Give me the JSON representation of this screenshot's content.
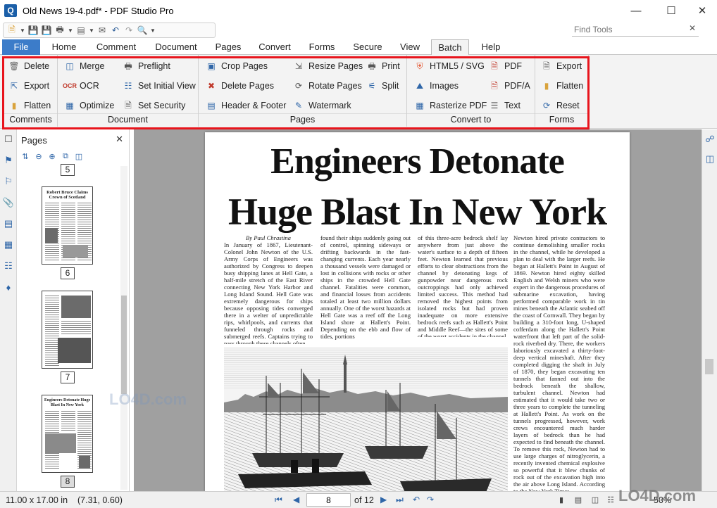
{
  "window": {
    "title": "Old News 19-4.pdf* - PDF Studio Pro",
    "logo": "Q"
  },
  "find_tools": {
    "placeholder": "Find Tools"
  },
  "menu": {
    "tabs": [
      {
        "label": "File"
      },
      {
        "label": "Home"
      },
      {
        "label": "Comment"
      },
      {
        "label": "Document"
      },
      {
        "label": "Pages"
      },
      {
        "label": "Convert"
      },
      {
        "label": "Forms"
      },
      {
        "label": "Secure"
      },
      {
        "label": "View"
      },
      {
        "label": "Batch"
      },
      {
        "label": "Help"
      }
    ],
    "active_tab": "Batch"
  },
  "ribbon": {
    "groups": [
      {
        "label": "Comments",
        "buttons": [
          "Delete",
          "Export",
          "Flatten"
        ]
      },
      {
        "label": "Document",
        "buttons": [
          "Merge",
          "OCR",
          "Optimize",
          "Preflight",
          "Set Initial View",
          "Set Security"
        ]
      },
      {
        "label": "Pages",
        "buttons": [
          "Crop Pages",
          "Delete Pages",
          "Header & Footer",
          "Resize Pages",
          "Rotate Pages",
          "Watermark",
          "Print",
          "Split"
        ]
      },
      {
        "label": "Convert to",
        "buttons": [
          "HTML5 / SVG",
          "Images",
          "Rasterize PDF",
          "PDF",
          "PDF/A",
          "Text"
        ]
      },
      {
        "label": "Forms",
        "buttons": [
          "Export",
          "Flatten",
          "Reset"
        ]
      }
    ],
    "highlight_color": "#e8141c"
  },
  "pages_panel": {
    "title": "Pages",
    "thumbnails": [
      {
        "number": "5"
      },
      {
        "number": "6",
        "title": "Robert Bruce Claims Crown of Scotland"
      },
      {
        "number": "7"
      },
      {
        "number": "8",
        "title": "Engineers Detonate Huge Blast In New York",
        "selected": true
      }
    ]
  },
  "document": {
    "headline_line1": "Engineers Detonate",
    "headline_line2": "Huge Blast In New York",
    "byline": "By Paul Chrastina",
    "columns": [
      "In January of 1867, Lieutenant-Colonel John Newton of the U.S. Army Corps of Engineers was authorized by Congress to deepen busy shipping lanes at Hell Gate, a half-mile stretch of the East River connecting New York Harbor and Long Island Sound. Hell Gate was extremely dangerous for ships because opposing tides converged there in a welter of unpredictable rips, whirlpools, and currents that funneled through rocks and submerged reefs. Captains trying to pass through these channels often",
      "found their ships suddenly going out of control, spinning sideways or drifting backwards in the fast-changing currents. Each year nearly a thousand vessels were damaged or lost in collisions with rocks or other ships in the crowded Hell Gate channel. Fatalities were common, and financial losses from accidents totaled at least two million dollars annually. One of the worst hazards at Hell Gate was a reef off the Long Island shore at Hallett's Point. Depending on the ebb and flow of tides, portions",
      "of this three-acre bedrock shelf lay anywhere from just above the water's surface to a depth of fifteen feet. Newton learned that previous efforts to clear obstructions from the channel by detonating kegs of gunpowder near dangerous rock outcroppings had only achieved limited success. This method had removed the highest points from isolated rocks but had proven inadequate on more extensive bedrock reefs such as Hallett's Point and Middle Reef—the sites of some of the worst accidents in the channel.",
      "Newton hired private contractors to continue demolishing smaller rocks in the channel, while he developed a plan to deal with the larger reefs. He began at Hallett's Point in August of 1869. Newton hired eighty skilled English and Welsh miners who were expert in the dangerous procedures of submarine excavation, having performed comparable work in tin mines beneath the Atlantic seabed off the coast of Cornwall. They began by building a 310-foot long, U-shaped cofferdam along the Hallett's Point waterfront that left part of the solid-rock riverbed dry. There, the workers laboriously excavated a thirty-foot-deep vertical mineshaft. After they completed digging the shaft in July of 1870, they began excavating ten tunnels that fanned out into the bedrock beneath the shallow, turbulent channel. Newton had estimated that it would take two or three years to complete the tunneling at Hallett's Point. As work on the tunnels progressed, however, work crews encountered much harder layers of bedrock than he had expected to find beneath the channel. To remove this rock, Newton had to use large charges of nitroglycerin, a recently invented chemical explosive so powerful that it blew chunks of rock out of the excavation high into the air above Long Island. According to the New York Times"
    ]
  },
  "statusbar": {
    "page_size": "11.00 x 17.00 in",
    "coords": "(7.31, 0.60)",
    "current_page": "8",
    "of_pages": "of 12",
    "zoom": "50%"
  },
  "watermark": "LO4D.com"
}
